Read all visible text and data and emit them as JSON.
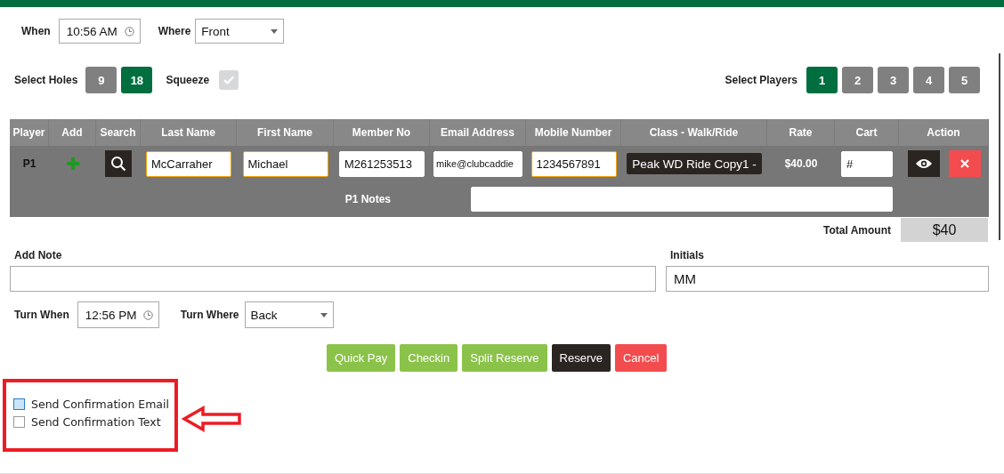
{
  "when": {
    "label": "When",
    "value": "10:56 AM"
  },
  "where": {
    "label": "Where",
    "value": "Front"
  },
  "holes": {
    "label": "Select Holes",
    "options": [
      {
        "label": "9",
        "selected": false
      },
      {
        "label": "18",
        "selected": true
      }
    ]
  },
  "squeeze": {
    "label": "Squeeze",
    "checked": true,
    "disabled": true
  },
  "players": {
    "label": "Select Players",
    "options": [
      {
        "label": "1",
        "selected": true
      },
      {
        "label": "2",
        "selected": false
      },
      {
        "label": "3",
        "selected": false
      },
      {
        "label": "4",
        "selected": false
      },
      {
        "label": "5",
        "selected": false
      }
    ]
  },
  "table": {
    "columns": [
      "Player",
      "Add",
      "Search",
      "Last Name",
      "First Name",
      "Member No",
      "Email Address",
      "Mobile Number",
      "Class - Walk/Ride",
      "Rate",
      "Cart",
      "Action"
    ],
    "rows": [
      {
        "cells": [
          {
            "kind": "text",
            "value": "P1"
          },
          {
            "kind": "add"
          },
          {
            "kind": "search"
          },
          {
            "kind": "input",
            "value": "McCarraher",
            "highlighted": true
          },
          {
            "kind": "input",
            "value": "Michael",
            "highlighted": true
          },
          {
            "kind": "input",
            "value": "M261253513",
            "highlighted": false
          },
          {
            "kind": "input",
            "value": "mike@clubcaddie",
            "highlighted": false
          },
          {
            "kind": "input",
            "value": "1234567891",
            "highlighted": true
          },
          {
            "kind": "dark",
            "value": "Peak WD Ride Copy1 -"
          },
          {
            "kind": "text",
            "value": "$40.00"
          },
          {
            "kind": "input",
            "value": "#",
            "highlighted": false
          },
          {
            "kind": "actions"
          }
        ],
        "notes_label": "P1 Notes"
      }
    ]
  },
  "total": {
    "label": "Total Amount",
    "value": "$40"
  },
  "add_note": {
    "label": "Add Note"
  },
  "initials": {
    "label": "Initials",
    "value": "MM"
  },
  "turn_when": {
    "label": "Turn When",
    "value": "12:56 PM"
  },
  "turn_where": {
    "label": "Turn Where",
    "value": "Back"
  },
  "actions": [
    {
      "label": "Quick Pay",
      "kind": "success"
    },
    {
      "label": "Checkin",
      "kind": "success"
    },
    {
      "label": "Split Reserve",
      "kind": "success"
    },
    {
      "label": "Reserve",
      "kind": "dark"
    },
    {
      "label": "Cancel",
      "kind": "danger"
    }
  ],
  "confirmations": [
    {
      "label": "Send Confirmation Email",
      "checked": false,
      "focused": true
    },
    {
      "label": "Send Confirmation Text",
      "checked": false,
      "focused": false
    }
  ]
}
